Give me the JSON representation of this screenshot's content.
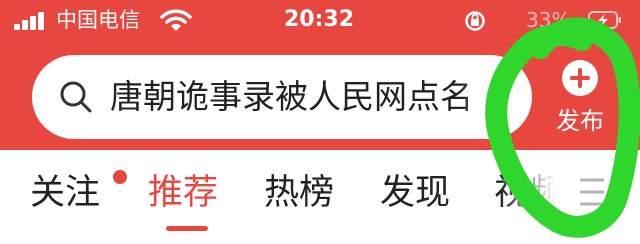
{
  "status_bar": {
    "carrier": "中国电信",
    "time": "20:32",
    "battery_text": "33%",
    "icons": [
      "signal-icon",
      "wifi-icon",
      "orientation-lock-icon",
      "battery-icon"
    ]
  },
  "search": {
    "text": "唐朝诡事录被人民网点名"
  },
  "publish": {
    "label": "发布",
    "icon": "plus-icon"
  },
  "tabs": [
    {
      "label": "关注",
      "has_dot": true
    },
    {
      "label": "推荐",
      "active": true
    },
    {
      "label": "热榜"
    },
    {
      "label": "发现"
    },
    {
      "label": "视频"
    }
  ],
  "more_icon": "menu-icon",
  "colors": {
    "brand_red": "#e8473f",
    "annotation_green": "#2fd62b",
    "white": "#ffffff"
  },
  "annotation": "green-circle-marker"
}
